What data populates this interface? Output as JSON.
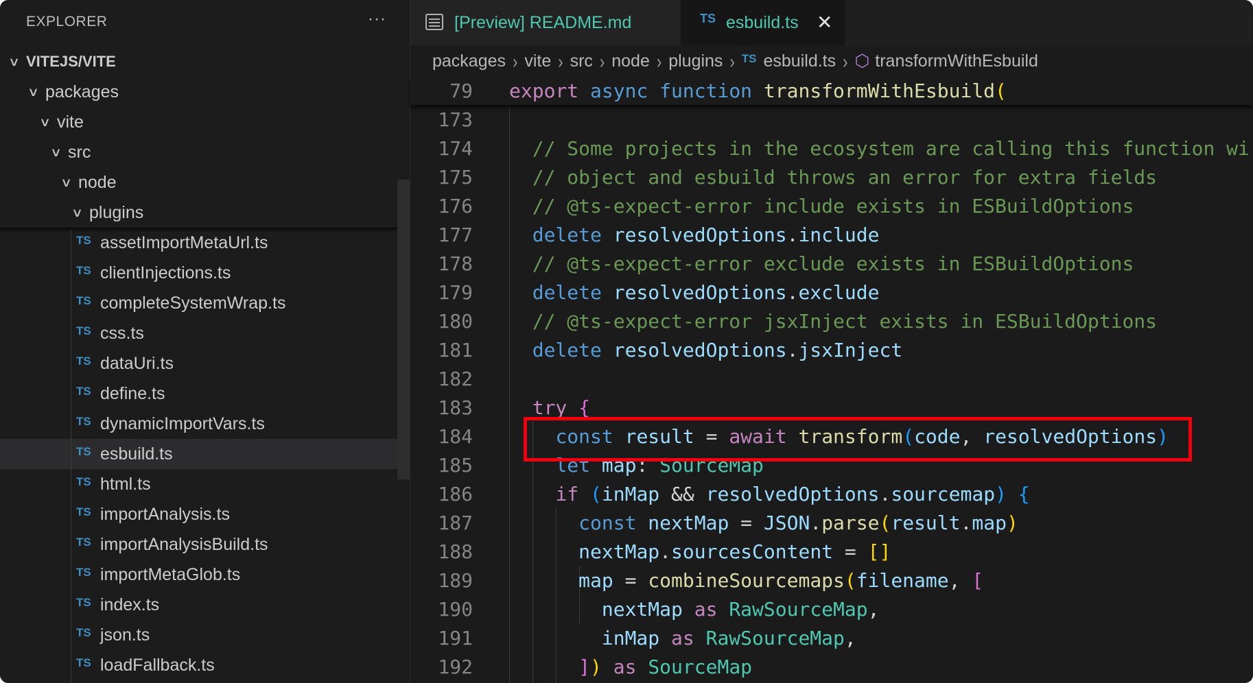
{
  "sidebar": {
    "title": "EXPLORER",
    "more": "···",
    "items": [
      {
        "label": "VITEJS/VITE",
        "type": "folder",
        "depth": 0
      },
      {
        "label": "packages",
        "type": "folder",
        "depth": 1
      },
      {
        "label": "vite",
        "type": "folder",
        "depth": 2
      },
      {
        "label": "src",
        "type": "folder",
        "depth": 3
      },
      {
        "label": "node",
        "type": "folder",
        "depth": 4
      },
      {
        "label": "plugins",
        "type": "folder",
        "depth": 5
      },
      {
        "label": "assetImportMetaUrl.ts",
        "type": "file"
      },
      {
        "label": "clientInjections.ts",
        "type": "file"
      },
      {
        "label": "completeSystemWrap.ts",
        "type": "file"
      },
      {
        "label": "css.ts",
        "type": "file"
      },
      {
        "label": "dataUri.ts",
        "type": "file"
      },
      {
        "label": "define.ts",
        "type": "file"
      },
      {
        "label": "dynamicImportVars.ts",
        "type": "file"
      },
      {
        "label": "esbuild.ts",
        "type": "file",
        "selected": true
      },
      {
        "label": "html.ts",
        "type": "file"
      },
      {
        "label": "importAnalysis.ts",
        "type": "file"
      },
      {
        "label": "importAnalysisBuild.ts",
        "type": "file"
      },
      {
        "label": "importMetaGlob.ts",
        "type": "file"
      },
      {
        "label": "index.ts",
        "type": "file"
      },
      {
        "label": "json.ts",
        "type": "file"
      },
      {
        "label": "loadFallback.ts",
        "type": "file"
      }
    ],
    "file_badge": "TS"
  },
  "tabs": [
    {
      "label": "[Preview] README.md",
      "icon": "preview-icon",
      "active": false
    },
    {
      "label": "esbuild.ts",
      "icon": "typescript-icon",
      "active": true,
      "close": "✕",
      "badge": "TS"
    }
  ],
  "breadcrumb": {
    "parts": [
      "packages",
      "vite",
      "src",
      "node",
      "plugins"
    ],
    "file": "esbuild.ts",
    "file_badge": "TS",
    "symbol": "transformWithEsbuild",
    "symbol_icon": "⬡",
    "separator": "›"
  },
  "editor": {
    "sticky": {
      "num": "79",
      "tokens": [
        [
          "export",
          "k"
        ],
        [
          " ",
          "p"
        ],
        [
          "async",
          "b"
        ],
        [
          " ",
          "p"
        ],
        [
          "function",
          "b"
        ],
        [
          " ",
          "p"
        ],
        [
          "transformWithEsbuild",
          "f"
        ],
        [
          "(",
          "y"
        ]
      ]
    },
    "lines": [
      {
        "num": "173",
        "tokens": []
      },
      {
        "num": "174",
        "tokens": [
          [
            "  // Some projects in the ecosystem are calling this function wi",
            "c"
          ]
        ]
      },
      {
        "num": "175",
        "tokens": [
          [
            "  // object and esbuild throws an error for extra fields",
            "c"
          ]
        ]
      },
      {
        "num": "176",
        "tokens": [
          [
            "  // @ts-expect-error include exists in ESBuildOptions",
            "c"
          ]
        ]
      },
      {
        "num": "177",
        "tokens": [
          [
            "  ",
            "p"
          ],
          [
            "delete",
            "b"
          ],
          [
            " resolvedOptions",
            "v"
          ],
          [
            ".",
            "p"
          ],
          [
            "include",
            "v"
          ]
        ]
      },
      {
        "num": "178",
        "tokens": [
          [
            "  // @ts-expect-error exclude exists in ESBuildOptions",
            "c"
          ]
        ]
      },
      {
        "num": "179",
        "tokens": [
          [
            "  ",
            "p"
          ],
          [
            "delete",
            "b"
          ],
          [
            " resolvedOptions",
            "v"
          ],
          [
            ".",
            "p"
          ],
          [
            "exclude",
            "v"
          ]
        ]
      },
      {
        "num": "180",
        "tokens": [
          [
            "  // @ts-expect-error jsxInject exists in ESBuildOptions",
            "c"
          ]
        ]
      },
      {
        "num": "181",
        "tokens": [
          [
            "  ",
            "p"
          ],
          [
            "delete",
            "b"
          ],
          [
            " resolvedOptions",
            "v"
          ],
          [
            ".",
            "p"
          ],
          [
            "jsxInject",
            "v"
          ]
        ]
      },
      {
        "num": "182",
        "tokens": []
      },
      {
        "num": "183",
        "tokens": [
          [
            "  ",
            "p"
          ],
          [
            "try",
            "k"
          ],
          [
            " ",
            "p"
          ],
          [
            "{",
            "m"
          ]
        ]
      },
      {
        "num": "184",
        "tokens": [
          [
            "    ",
            "p"
          ],
          [
            "const",
            "b"
          ],
          [
            " result",
            "v"
          ],
          [
            " = ",
            "p"
          ],
          [
            "await",
            "k"
          ],
          [
            " ",
            "p"
          ],
          [
            "transform",
            "f"
          ],
          [
            "(",
            "bl"
          ],
          [
            "code",
            "v"
          ],
          [
            ", ",
            "p"
          ],
          [
            "resolvedOptions",
            "v"
          ],
          [
            ")",
            "bl"
          ]
        ]
      },
      {
        "num": "185",
        "tokens": [
          [
            "    ",
            "p"
          ],
          [
            "let",
            "b"
          ],
          [
            " map",
            "v"
          ],
          [
            ": ",
            "p"
          ],
          [
            "SourceMap",
            "t"
          ]
        ]
      },
      {
        "num": "186",
        "tokens": [
          [
            "    ",
            "p"
          ],
          [
            "if",
            "k"
          ],
          [
            " ",
            "p"
          ],
          [
            "(",
            "bl"
          ],
          [
            "inMap",
            "v"
          ],
          [
            " && ",
            "p"
          ],
          [
            "resolvedOptions",
            "v"
          ],
          [
            ".",
            "p"
          ],
          [
            "sourcemap",
            "v"
          ],
          [
            ")",
            "bl"
          ],
          [
            " ",
            "p"
          ],
          [
            "{",
            "bl"
          ]
        ]
      },
      {
        "num": "187",
        "tokens": [
          [
            "      ",
            "p"
          ],
          [
            "const",
            "b"
          ],
          [
            " nextMap",
            "v"
          ],
          [
            " = ",
            "p"
          ],
          [
            "JSON",
            "v"
          ],
          [
            ".",
            "p"
          ],
          [
            "parse",
            "f"
          ],
          [
            "(",
            "y"
          ],
          [
            "result",
            "v"
          ],
          [
            ".",
            "p"
          ],
          [
            "map",
            "v"
          ],
          [
            ")",
            "y"
          ]
        ]
      },
      {
        "num": "188",
        "tokens": [
          [
            "      ",
            "p"
          ],
          [
            "nextMap",
            "v"
          ],
          [
            ".",
            "p"
          ],
          [
            "sourcesContent",
            "v"
          ],
          [
            " = ",
            "p"
          ],
          [
            "[]",
            "y"
          ]
        ]
      },
      {
        "num": "189",
        "tokens": [
          [
            "      ",
            "p"
          ],
          [
            "map",
            "v"
          ],
          [
            " = ",
            "p"
          ],
          [
            "combineSourcemaps",
            "f"
          ],
          [
            "(",
            "y"
          ],
          [
            "filename",
            "v"
          ],
          [
            ", ",
            "p"
          ],
          [
            "[",
            "m"
          ]
        ]
      },
      {
        "num": "190",
        "tokens": [
          [
            "        ",
            "p"
          ],
          [
            "nextMap",
            "v"
          ],
          [
            " as",
            "k"
          ],
          [
            " ",
            "p"
          ],
          [
            "RawSourceMap",
            "t"
          ],
          [
            ",",
            "p"
          ]
        ]
      },
      {
        "num": "191",
        "tokens": [
          [
            "        ",
            "p"
          ],
          [
            "inMap",
            "v"
          ],
          [
            " as",
            "k"
          ],
          [
            " ",
            "p"
          ],
          [
            "RawSourceMap",
            "t"
          ],
          [
            ",",
            "p"
          ]
        ]
      },
      {
        "num": "192",
        "tokens": [
          [
            "      ",
            "p"
          ],
          [
            "]",
            "m"
          ],
          [
            ")",
            "y"
          ],
          [
            " as",
            "k"
          ],
          [
            " ",
            "p"
          ],
          [
            "SourceMap",
            "t"
          ]
        ]
      }
    ],
    "highlight_line": "184",
    "highlight_color": "#f2000d"
  }
}
